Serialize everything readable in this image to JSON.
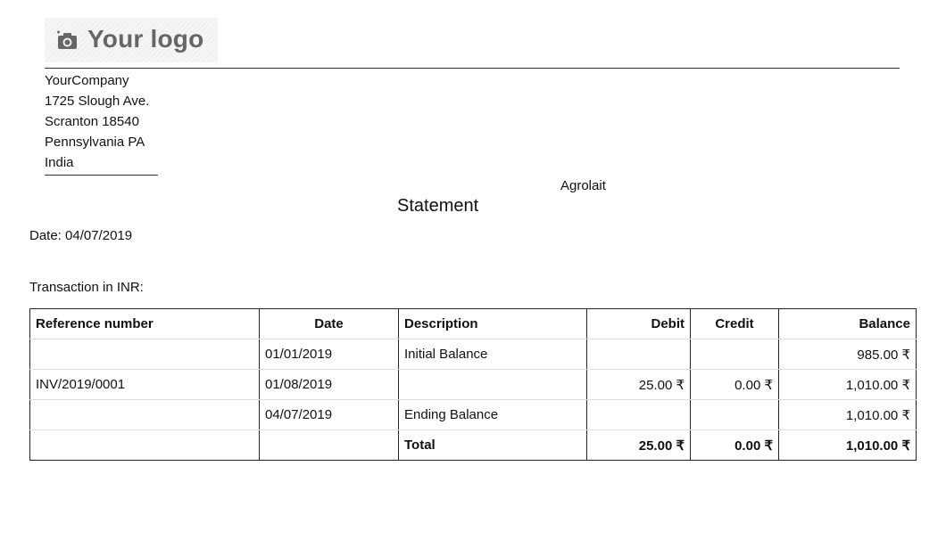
{
  "logo": {
    "icon": "camera-plus-icon",
    "text": "Your logo"
  },
  "company": {
    "lines": [
      "YourCompany",
      "1725 Slough Ave.",
      "Scranton 18540",
      "Pennsylvania PA",
      "India"
    ]
  },
  "partner_name": "Agrolait",
  "title": "Statement",
  "date_line": "Date: 04/07/2019",
  "currency_line": "Transaction in INR:",
  "table": {
    "headers": [
      "Reference number",
      "Date",
      "Description",
      "Debit",
      "Credit",
      "Balance"
    ],
    "rows": [
      [
        "",
        "01/01/2019",
        "Initial Balance",
        "",
        "",
        "985.00 ₹"
      ],
      [
        "INV/2019/0001",
        "01/08/2019",
        "",
        "25.00 ₹",
        "0.00 ₹",
        "1,010.00 ₹"
      ],
      [
        "",
        "04/07/2019",
        "Ending Balance",
        "",
        "",
        "1,010.00 ₹"
      ]
    ],
    "total": [
      "",
      "",
      "Total",
      "25.00 ₹",
      "0.00 ₹",
      "1,010.00 ₹"
    ]
  }
}
